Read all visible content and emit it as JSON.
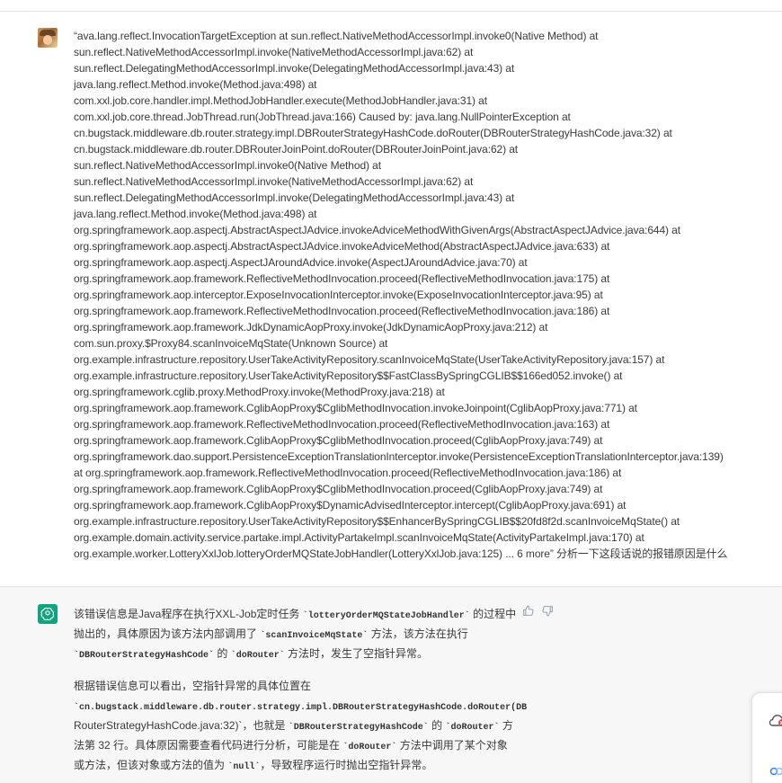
{
  "conversation": {
    "user_message": {
      "lines": [
        "“ava.lang.reflect.InvocationTargetException at sun.reflect.NativeMethodAccessorImpl.invoke0(Native Method) at",
        "sun.reflect.NativeMethodAccessorImpl.invoke(NativeMethodAccessorImpl.java:62) at",
        "sun.reflect.DelegatingMethodAccessorImpl.invoke(DelegatingMethodAccessorImpl.java:43) at",
        "java.lang.reflect.Method.invoke(Method.java:498) at",
        "com.xxl.job.core.handler.impl.MethodJobHandler.execute(MethodJobHandler.java:31) at",
        "com.xxl.job.core.thread.JobThread.run(JobThread.java:166) Caused by: java.lang.NullPointerException at",
        "cn.bugstack.middleware.db.router.strategy.impl.DBRouterStrategyHashCode.doRouter(DBRouterStrategyHashCode.java:32) at",
        "cn.bugstack.middleware.db.router.DBRouterJoinPoint.doRouter(DBRouterJoinPoint.java:62) at",
        "sun.reflect.NativeMethodAccessorImpl.invoke0(Native Method) at",
        "sun.reflect.NativeMethodAccessorImpl.invoke(NativeMethodAccessorImpl.java:62) at",
        "sun.reflect.DelegatingMethodAccessorImpl.invoke(DelegatingMethodAccessorImpl.java:43) at",
        "java.lang.reflect.Method.invoke(Method.java:498) at",
        "org.springframework.aop.aspectj.AbstractAspectJAdvice.invokeAdviceMethodWithGivenArgs(AbstractAspectJAdvice.java:644) at",
        "org.springframework.aop.aspectj.AbstractAspectJAdvice.invokeAdviceMethod(AbstractAspectJAdvice.java:633) at",
        "org.springframework.aop.aspectj.AspectJAroundAdvice.invoke(AspectJAroundAdvice.java:70) at",
        "org.springframework.aop.framework.ReflectiveMethodInvocation.proceed(ReflectiveMethodInvocation.java:175) at",
        "org.springframework.aop.interceptor.ExposeInvocationInterceptor.invoke(ExposeInvocationInterceptor.java:95) at",
        "org.springframework.aop.framework.ReflectiveMethodInvocation.proceed(ReflectiveMethodInvocation.java:186) at",
        "org.springframework.aop.framework.JdkDynamicAopProxy.invoke(JdkDynamicAopProxy.java:212) at",
        "com.sun.proxy.$Proxy84.scanInvoiceMqState(Unknown Source) at",
        "org.example.infrastructure.repository.UserTakeActivityRepository.scanInvoiceMqState(UserTakeActivityRepository.java:157) at",
        "org.example.infrastructure.repository.UserTakeActivityRepository$$FastClassBySpringCGLIB$$166ed052.invoke() at",
        "org.springframework.cglib.proxy.MethodProxy.invoke(MethodProxy.java:218) at",
        "org.springframework.aop.framework.CglibAopProxy$CglibMethodInvocation.invokeJoinpoint(CglibAopProxy.java:771) at",
        "org.springframework.aop.framework.ReflectiveMethodInvocation.proceed(ReflectiveMethodInvocation.java:163) at",
        "org.springframework.aop.framework.CglibAopProxy$CglibMethodInvocation.proceed(CglibAopProxy.java:749) at",
        "org.springframework.dao.support.PersistenceExceptionTranslationInterceptor.invoke(PersistenceExceptionTranslationInterceptor.java:139)",
        "at org.springframework.aop.framework.ReflectiveMethodInvocation.proceed(ReflectiveMethodInvocation.java:186) at",
        "org.springframework.aop.framework.CglibAopProxy$CglibMethodInvocation.proceed(CglibAopProxy.java:749) at",
        "org.springframework.aop.framework.CglibAopProxy$DynamicAdvisedInterceptor.intercept(CglibAopProxy.java:691) at",
        "org.example.infrastructure.repository.UserTakeActivityRepository$$EnhancerBySpringCGLIB$$20fd8f2d.scanInvoiceMqState() at",
        "org.example.domain.activity.service.partake.impl.ActivityPartakeImpl.scanInvoiceMqState(ActivityPartakeImpl.java:170) at",
        "org.example.worker.LotteryXxlJob.lotteryOrderMQStateJobHandler(LotteryXxlJob.java:125) ... 6 more” 分析一下这段话说的报错原因是什么"
      ]
    },
    "assistant_message": {
      "p1": [
        [
          "该错误信息是Java程序在执行XXL-Job定时任务 ",
          "`lotteryOrderMQStateJobHandler`",
          " 的过程中"
        ],
        [
          "抛出的，具体原因为该方法内部调用了 ",
          "`scanInvoiceMqState`",
          " 方法，该方法在执行"
        ],
        [
          "",
          "`DBRouterStrategyHashCode`",
          " 的 ",
          "`doRouter`",
          " 方法时，发生了空指针异常。"
        ]
      ],
      "p2": [
        [
          "根据错误信息可以看出，空指针异常的具体位置在"
        ],
        [
          "",
          "`cn.bugstack.middleware.db.router.strategy.impl.DBRouterStrategyHashCode.doRouter(DB"
        ],
        [
          "",
          "RouterStrategyHashCode.java:32)`",
          "，也就是 ",
          "`DBRouterStrategyHashCode`",
          " 的 ",
          "`doRouter`",
          " 方"
        ],
        [
          "法第 32 行。具体原因需要查看代码进行分析，可能是在 ",
          "`doRouter`",
          " 方法中调用了某个对象"
        ],
        [
          "或方法，但该对象或方法的值为 ",
          "`null`",
          "，导致程序运行时抛出空指针异常。"
        ]
      ]
    }
  },
  "icons": {
    "user_avatar": "avatar-image",
    "assistant_avatar": "openai-logo-icon",
    "thumbs_up": "thumbs-up-icon",
    "thumbs_down": "thumbs-down-icon",
    "float_cloud": "cloud-icon",
    "float_link": "link-icon"
  },
  "colors": {
    "assistant_bg": "#f7f7f8",
    "assistant_avatar_bg": "#10a37f",
    "text": "#3a3a3a"
  }
}
